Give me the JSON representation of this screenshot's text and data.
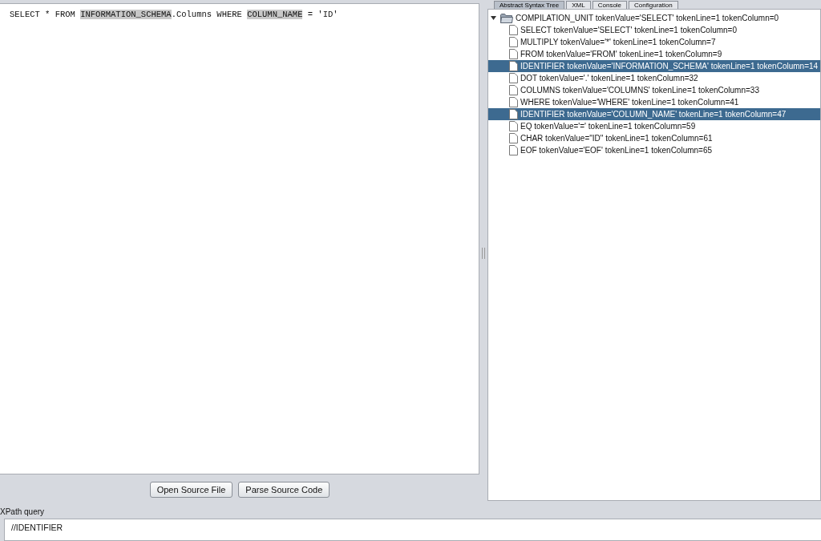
{
  "editor": {
    "segments": [
      {
        "text": "SELECT * FROM ",
        "highlighted": false
      },
      {
        "text": "INFORMATION_SCHEMA",
        "highlighted": true
      },
      {
        "text": ".Columns WHERE ",
        "highlighted": false
      },
      {
        "text": "COLUMN_NAME",
        "highlighted": true
      },
      {
        "text": " = 'ID'",
        "highlighted": false
      }
    ]
  },
  "buttons": [
    "Open Source File",
    "Parse Source Code"
  ],
  "tabs": [
    {
      "label": "Abstract Syntax Tree",
      "selected": true
    },
    {
      "label": "XML",
      "selected": false
    },
    {
      "label": "Console",
      "selected": false
    },
    {
      "label": "Configuration",
      "selected": false
    }
  ],
  "tree": [
    {
      "label": "COMPILATION_UNIT tokenValue='SELECT' tokenLine=1 tokenColumn=0",
      "selected": false,
      "expanded": true,
      "children": [
        {
          "label": "SELECT tokenValue='SELECT' tokenLine=1 tokenColumn=0",
          "selected": false
        },
        {
          "label": "MULTIPLY tokenValue='*' tokenLine=1 tokenColumn=7",
          "selected": false
        },
        {
          "label": "FROM tokenValue='FROM' tokenLine=1 tokenColumn=9",
          "selected": false
        },
        {
          "label": "IDENTIFIER tokenValue='INFORMATION_SCHEMA' tokenLine=1 tokenColumn=14",
          "selected": true
        },
        {
          "label": "DOT tokenValue='.' tokenLine=1 tokenColumn=32",
          "selected": false
        },
        {
          "label": "COLUMNS tokenValue='COLUMNS' tokenLine=1 tokenColumn=33",
          "selected": false
        },
        {
          "label": "WHERE tokenValue='WHERE' tokenLine=1 tokenColumn=41",
          "selected": false
        },
        {
          "label": "IDENTIFIER tokenValue='COLUMN_NAME' tokenLine=1 tokenColumn=47",
          "selected": true
        },
        {
          "label": "EQ tokenValue='=' tokenLine=1 tokenColumn=59",
          "selected": false
        },
        {
          "label": "CHAR tokenValue=\"ID\" tokenLine=1 tokenColumn=61",
          "selected": false
        },
        {
          "label": "EOF tokenValue='EOF' tokenLine=1 tokenColumn=65",
          "selected": false
        }
      ]
    }
  ],
  "xpath": {
    "label": "XPath query",
    "value": "//IDENTIFIER"
  }
}
